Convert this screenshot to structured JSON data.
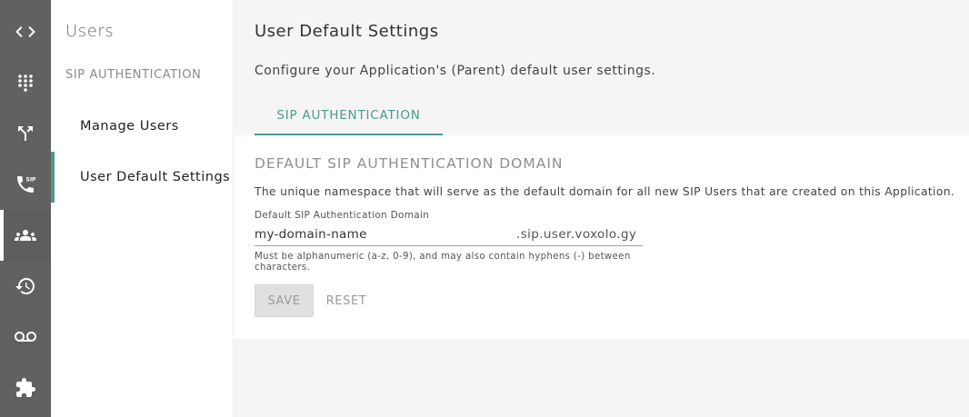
{
  "rail": {
    "items": [
      {
        "icon": "code-icon"
      },
      {
        "icon": "dialpad-icon"
      },
      {
        "icon": "call-split-icon"
      },
      {
        "icon": "sip-phone-icon"
      },
      {
        "icon": "users-icon",
        "active": true
      },
      {
        "icon": "history-icon"
      },
      {
        "icon": "voicemail-icon"
      },
      {
        "icon": "extension-icon"
      }
    ]
  },
  "sidebar": {
    "title": "Users",
    "section": "SIP AUTHENTICATION",
    "links": [
      {
        "label": "Manage Users",
        "active": false
      },
      {
        "label": "User Default Settings",
        "active": true
      }
    ]
  },
  "main": {
    "title": "User Default Settings",
    "description": "Configure your Application's (Parent) default user settings.",
    "tab": "SIP AUTHENTICATION",
    "card": {
      "heading": "DEFAULT SIP AUTHENTICATION DOMAIN",
      "description": "The unique namespace that will serve as the default domain for all new SIP Users that are created on this Application.",
      "field": {
        "label": "Default SIP Authentication Domain",
        "value": "my-domain-name",
        "suffix": ".sip.user.voxolo.gy"
      },
      "helper": "Must be alphanumeric (a-z, 0-9), and may also contain hyphens (-) between characters.",
      "save_label": "SAVE",
      "reset_label": "RESET"
    }
  },
  "colors": {
    "accent": "#4a9a8c",
    "rail": "#616161"
  }
}
